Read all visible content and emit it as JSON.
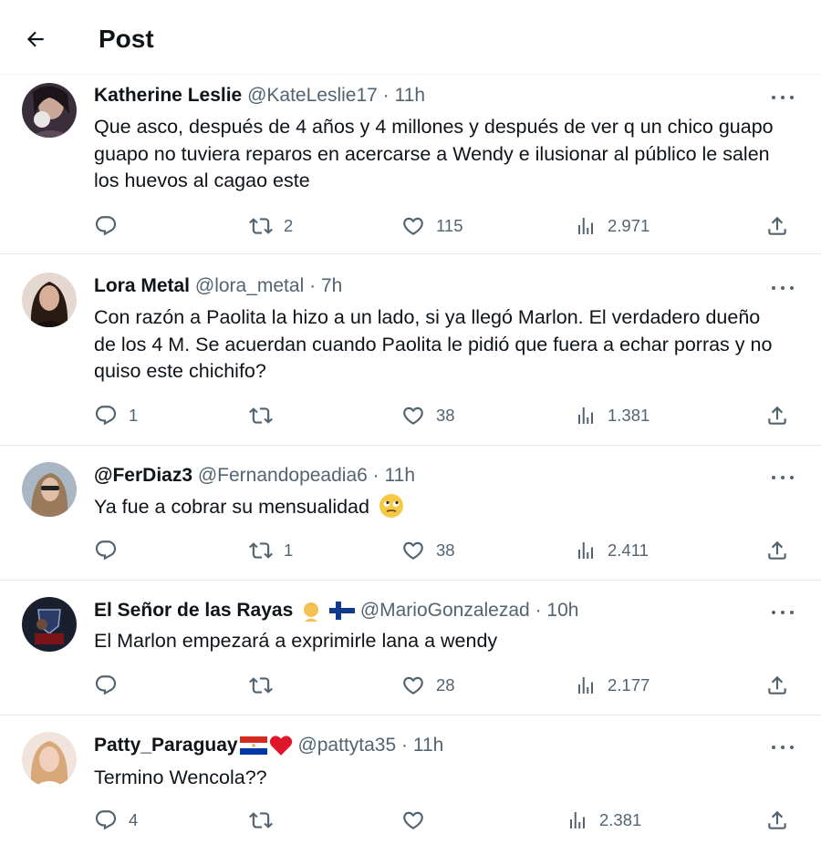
{
  "header": {
    "title": "Post"
  },
  "tweets": [
    {
      "name": "Katherine Leslie",
      "handle": "@KateLeslie17",
      "time": "11h",
      "text": "Que asco, después de 4 años y 4 millones y después de ver q un chico guapo guapo no tuviera reparos en acercarse a Wendy e ilusionar al público le salen los huevos al cagao este",
      "replies": "",
      "retweets": "2",
      "likes": "115",
      "views": "2.971"
    },
    {
      "name": "Lora Metal",
      "handle": "@lora_metal",
      "time": "7h",
      "text": "Con razón a Paolita la hizo a un lado, si ya llegó Marlon. El verdadero dueño de los 4 M. Se acuerdan cuando Paolita le pidió que fuera a echar porras y no quiso este chichifo?",
      "replies": "1",
      "retweets": "",
      "likes": "38",
      "views": "1.381"
    },
    {
      "name": "@FerDiaz3",
      "handle": "@Fernandopeadia6",
      "time": "11h",
      "text": "Ya fue a cobrar su mensualidad",
      "emoji": "eye-roll-emoji",
      "replies": "",
      "retweets": "1",
      "likes": "38",
      "views": "2.411"
    },
    {
      "name": "El Señor de las Rayas",
      "handle": "@MarioGonzalezad",
      "time": "10h",
      "text": "El Marlon empezará a exprimirle lana a wendy",
      "name_emojis": [
        "person-emoji",
        "finland-flag"
      ],
      "replies": "",
      "retweets": "",
      "likes": "28",
      "views": "2.177"
    },
    {
      "name": "Patty_Paraguay",
      "handle": "@pattyta35",
      "time": "11h",
      "text": "Termino Wencola??",
      "name_emojis": [
        "paraguay-flag",
        "red-heart"
      ],
      "replies": "4",
      "retweets": "",
      "likes": "",
      "views": "2.381"
    }
  ],
  "icons": {
    "back": "arrow-left-icon",
    "more": "more-horizontal-icon",
    "reply": "reply-icon",
    "retweet": "retweet-icon",
    "like": "heart-icon",
    "views": "views-chart-icon",
    "share": "share-icon"
  },
  "colors": {
    "text": "#0f1419",
    "muted": "#536471",
    "divider": "#eff3f4"
  }
}
